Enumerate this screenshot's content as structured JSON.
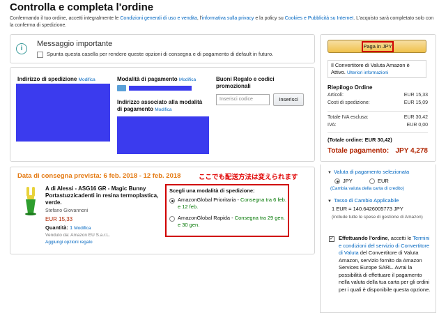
{
  "header": {
    "title": "Controlla e completa l'ordine",
    "intro_1": "Confermando il tuo ordine, accetti integralmente le ",
    "intro_link1": "Condizioni generali di uso e vendita",
    "intro_2": ", l'",
    "intro_link2": "informativa sulla privacy",
    "intro_3": " e la policy su ",
    "intro_link3": "Cookies e Pubblicità su Internet",
    "intro_4": ". L'acquisto sarà completato solo con la conferma di spedizione."
  },
  "message": {
    "title": "Messaggio importante",
    "checkbox_label": "Spunta questa casella per rendere queste opzioni di consegna e di pagamento di default in futuro."
  },
  "address": {
    "shipping_header": "Indirizzo di spedizione",
    "modify": "Modifica",
    "payment_header": "Modalità di pagamento",
    "billing_header": "Indirizzo associato alla modalità di pagamento",
    "gift_header": "Buoni Regalo e codici promozionali",
    "promo_placeholder": "Inserisci codice",
    "promo_button": "Inserisci"
  },
  "delivery": {
    "date_label": "Data di consegna prevista:  6 feb. 2018 - 12 feb. 2018",
    "jp_note": "ここでも配送方法は変えられます",
    "product": {
      "title": "A di Alessi - ASG16 GR - Magic Bunny Portastuzzicadenti in resina termoplastica, verde.",
      "author": "Stefano Giovannoni",
      "price": "EUR 15,33",
      "qty_label": "Quantità: ",
      "qty_value": "1",
      "modify": "Modifica",
      "sold_by": "Venduto da: Amazon EU S.a.r.L.",
      "gift": "Aggiungi opzioni regalo"
    },
    "shipping": {
      "header": "Scegli una modalità di spedizione:",
      "options": [
        {
          "name": "AmazonGlobal Prioritaria",
          "sep": " - ",
          "detail": "Consegna tra 6 feb. e 12 feb.",
          "selected": true
        },
        {
          "name": "AmazonGlobal Rapida",
          "sep": " - ",
          "detail": "Consegna tra 29 gen. e 30 gen.",
          "selected": false
        }
      ]
    }
  },
  "summary": {
    "pay_button": "Paga in JPY",
    "converter_text": "Il Convertitore di Valuta Amazon è Attivo.",
    "converter_link": "Ulteriori informazioni",
    "header": "Riepilogo Ordine",
    "rows": [
      {
        "label": "Articoli:",
        "value": "EUR 15,33"
      },
      {
        "label": "Costi di spedizione:",
        "value": "EUR 15,09"
      },
      {
        "label": "Totale IVA esclusa:",
        "value": "EUR 30,42"
      },
      {
        "label": "IVA:",
        "value": "EUR 0,00"
      }
    ],
    "total_order": "(Totale ordine: EUR 30,42)",
    "total_pay_label": "Totale pagamento:",
    "total_pay_value": "JPY 4,278"
  },
  "currency": {
    "header": "Valuta di pagamento selezionata",
    "opt1": "JPY",
    "opt2": "EUR",
    "change_link": "(Cambia valuta della carta di credito)",
    "rate_header": "Tasso di Cambio Applicabile",
    "rate": "1 EUR = 140.6426005773 JPY",
    "rate_note": "(include tutte le spese di gestione di Amazon)",
    "agree_bold": "Effettuando l'ordine",
    "agree_1": ", accetti le ",
    "agree_link": "Termini e condizioni del servizio di Convertitore di Valuta",
    "agree_2": " del Convertitore di Valuta Amazon, servizio fornito da Amazon Services Europe SARL. Avrai la possibilità di effettuare il pagamento nella valuta della tua carta per gli ordini per i quali è disponibile questa opzione."
  },
  "colors": {
    "accent_orange": "#e47911",
    "price_red": "#b12704",
    "link_blue": "#0066c0",
    "highlight_red": "#d00000",
    "redaction_blue": "#3b3bee"
  }
}
